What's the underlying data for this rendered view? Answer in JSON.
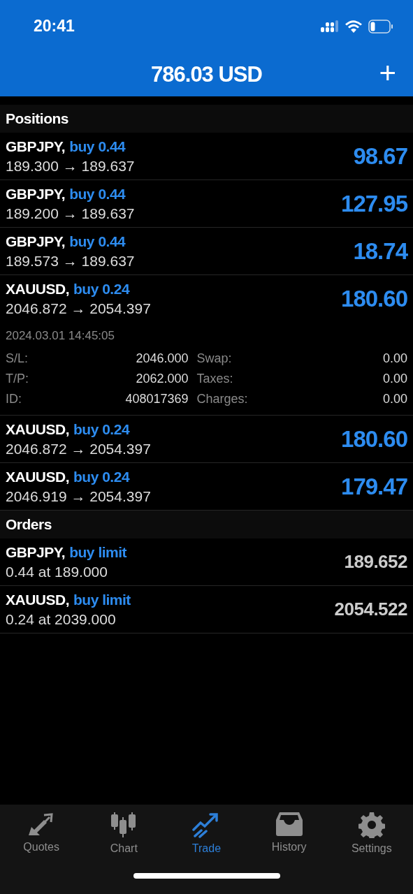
{
  "status_bar": {
    "time": "20:41"
  },
  "header": {
    "title": "786.03 USD",
    "add": "+"
  },
  "positions_title": "Positions",
  "positions": [
    {
      "symbol": "GBPJPY,",
      "side": "buy 0.44",
      "prices": "189.300 → 189.637",
      "profit": "98.67",
      "expanded": false
    },
    {
      "symbol": "GBPJPY,",
      "side": "buy 0.44",
      "prices": "189.200 → 189.637",
      "profit": "127.95",
      "expanded": false
    },
    {
      "symbol": "GBPJPY,",
      "side": "buy 0.44",
      "prices": "189.573 → 189.637",
      "profit": "18.74",
      "expanded": false
    },
    {
      "symbol": "XAUUSD,",
      "side": "buy 0.24",
      "prices": "2046.872 → 2054.397",
      "profit": "180.60",
      "expanded": true,
      "time": "2024.03.01 14:45:05",
      "details": [
        {
          "label": "S/L:",
          "value": "2046.000",
          "label2": "Swap:",
          "value2": "0.00"
        },
        {
          "label": "T/P:",
          "value": "2062.000",
          "label2": "Taxes:",
          "value2": "0.00"
        },
        {
          "label": "ID:",
          "value": "408017369",
          "label2": "Charges:",
          "value2": "0.00"
        }
      ]
    },
    {
      "symbol": "XAUUSD,",
      "side": "buy 0.24",
      "prices": "2046.872 → 2054.397",
      "profit": "180.60",
      "expanded": false
    },
    {
      "symbol": "XAUUSD,",
      "side": "buy 0.24",
      "prices": "2046.919 → 2054.397",
      "profit": "179.47",
      "expanded": false
    }
  ],
  "orders_title": "Orders",
  "orders": [
    {
      "symbol": "GBPJPY,",
      "side": "buy limit",
      "details": "0.44 at 189.000",
      "price": "189.652"
    },
    {
      "symbol": "XAUUSD,",
      "side": "buy limit",
      "details": "0.24 at 2039.000",
      "price": "2054.522"
    }
  ],
  "tabs": [
    {
      "label": "Quotes",
      "kind": "quotes",
      "selected": false
    },
    {
      "label": "Chart",
      "kind": "chart",
      "selected": false
    },
    {
      "label": "Trade",
      "kind": "trade",
      "selected": true
    },
    {
      "label": "History",
      "kind": "history",
      "selected": false
    },
    {
      "label": "Settings",
      "kind": "settings",
      "selected": false
    }
  ]
}
